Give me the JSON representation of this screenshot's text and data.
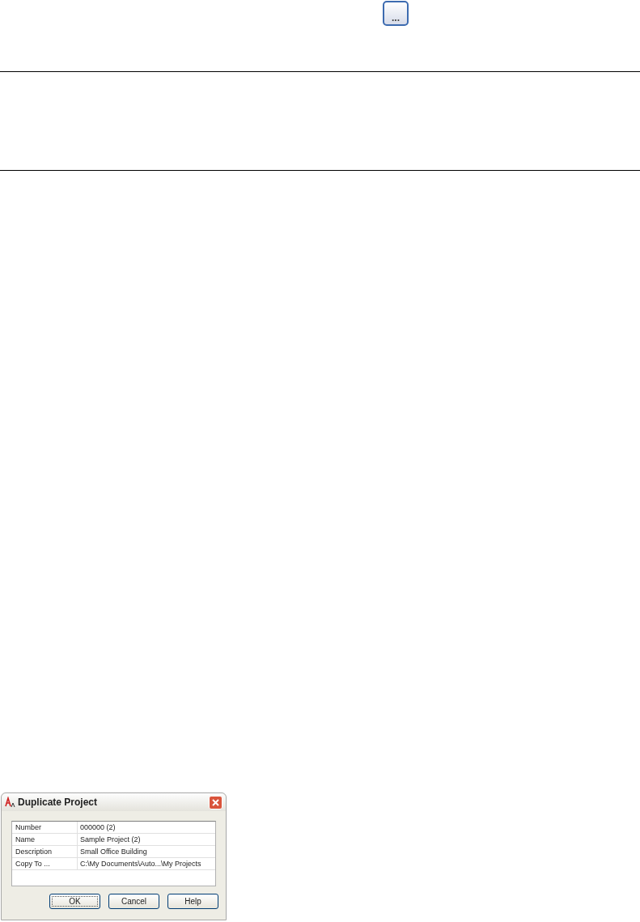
{
  "browse_button": {
    "label": "..."
  },
  "dialog": {
    "title": "Duplicate Project",
    "rows": [
      {
        "label": "Number",
        "value": "000000 (2)"
      },
      {
        "label": "Name",
        "value": "Sample Project (2)"
      },
      {
        "label": "Description",
        "value": "Small Office Building"
      },
      {
        "label": "Copy To ...",
        "value": "C:\\My Documents\\Auto...\\My Projects"
      }
    ],
    "buttons": [
      {
        "label": "OK",
        "selected": true
      },
      {
        "label": "Cancel",
        "selected": false
      },
      {
        "label": "Help",
        "selected": false
      }
    ]
  }
}
